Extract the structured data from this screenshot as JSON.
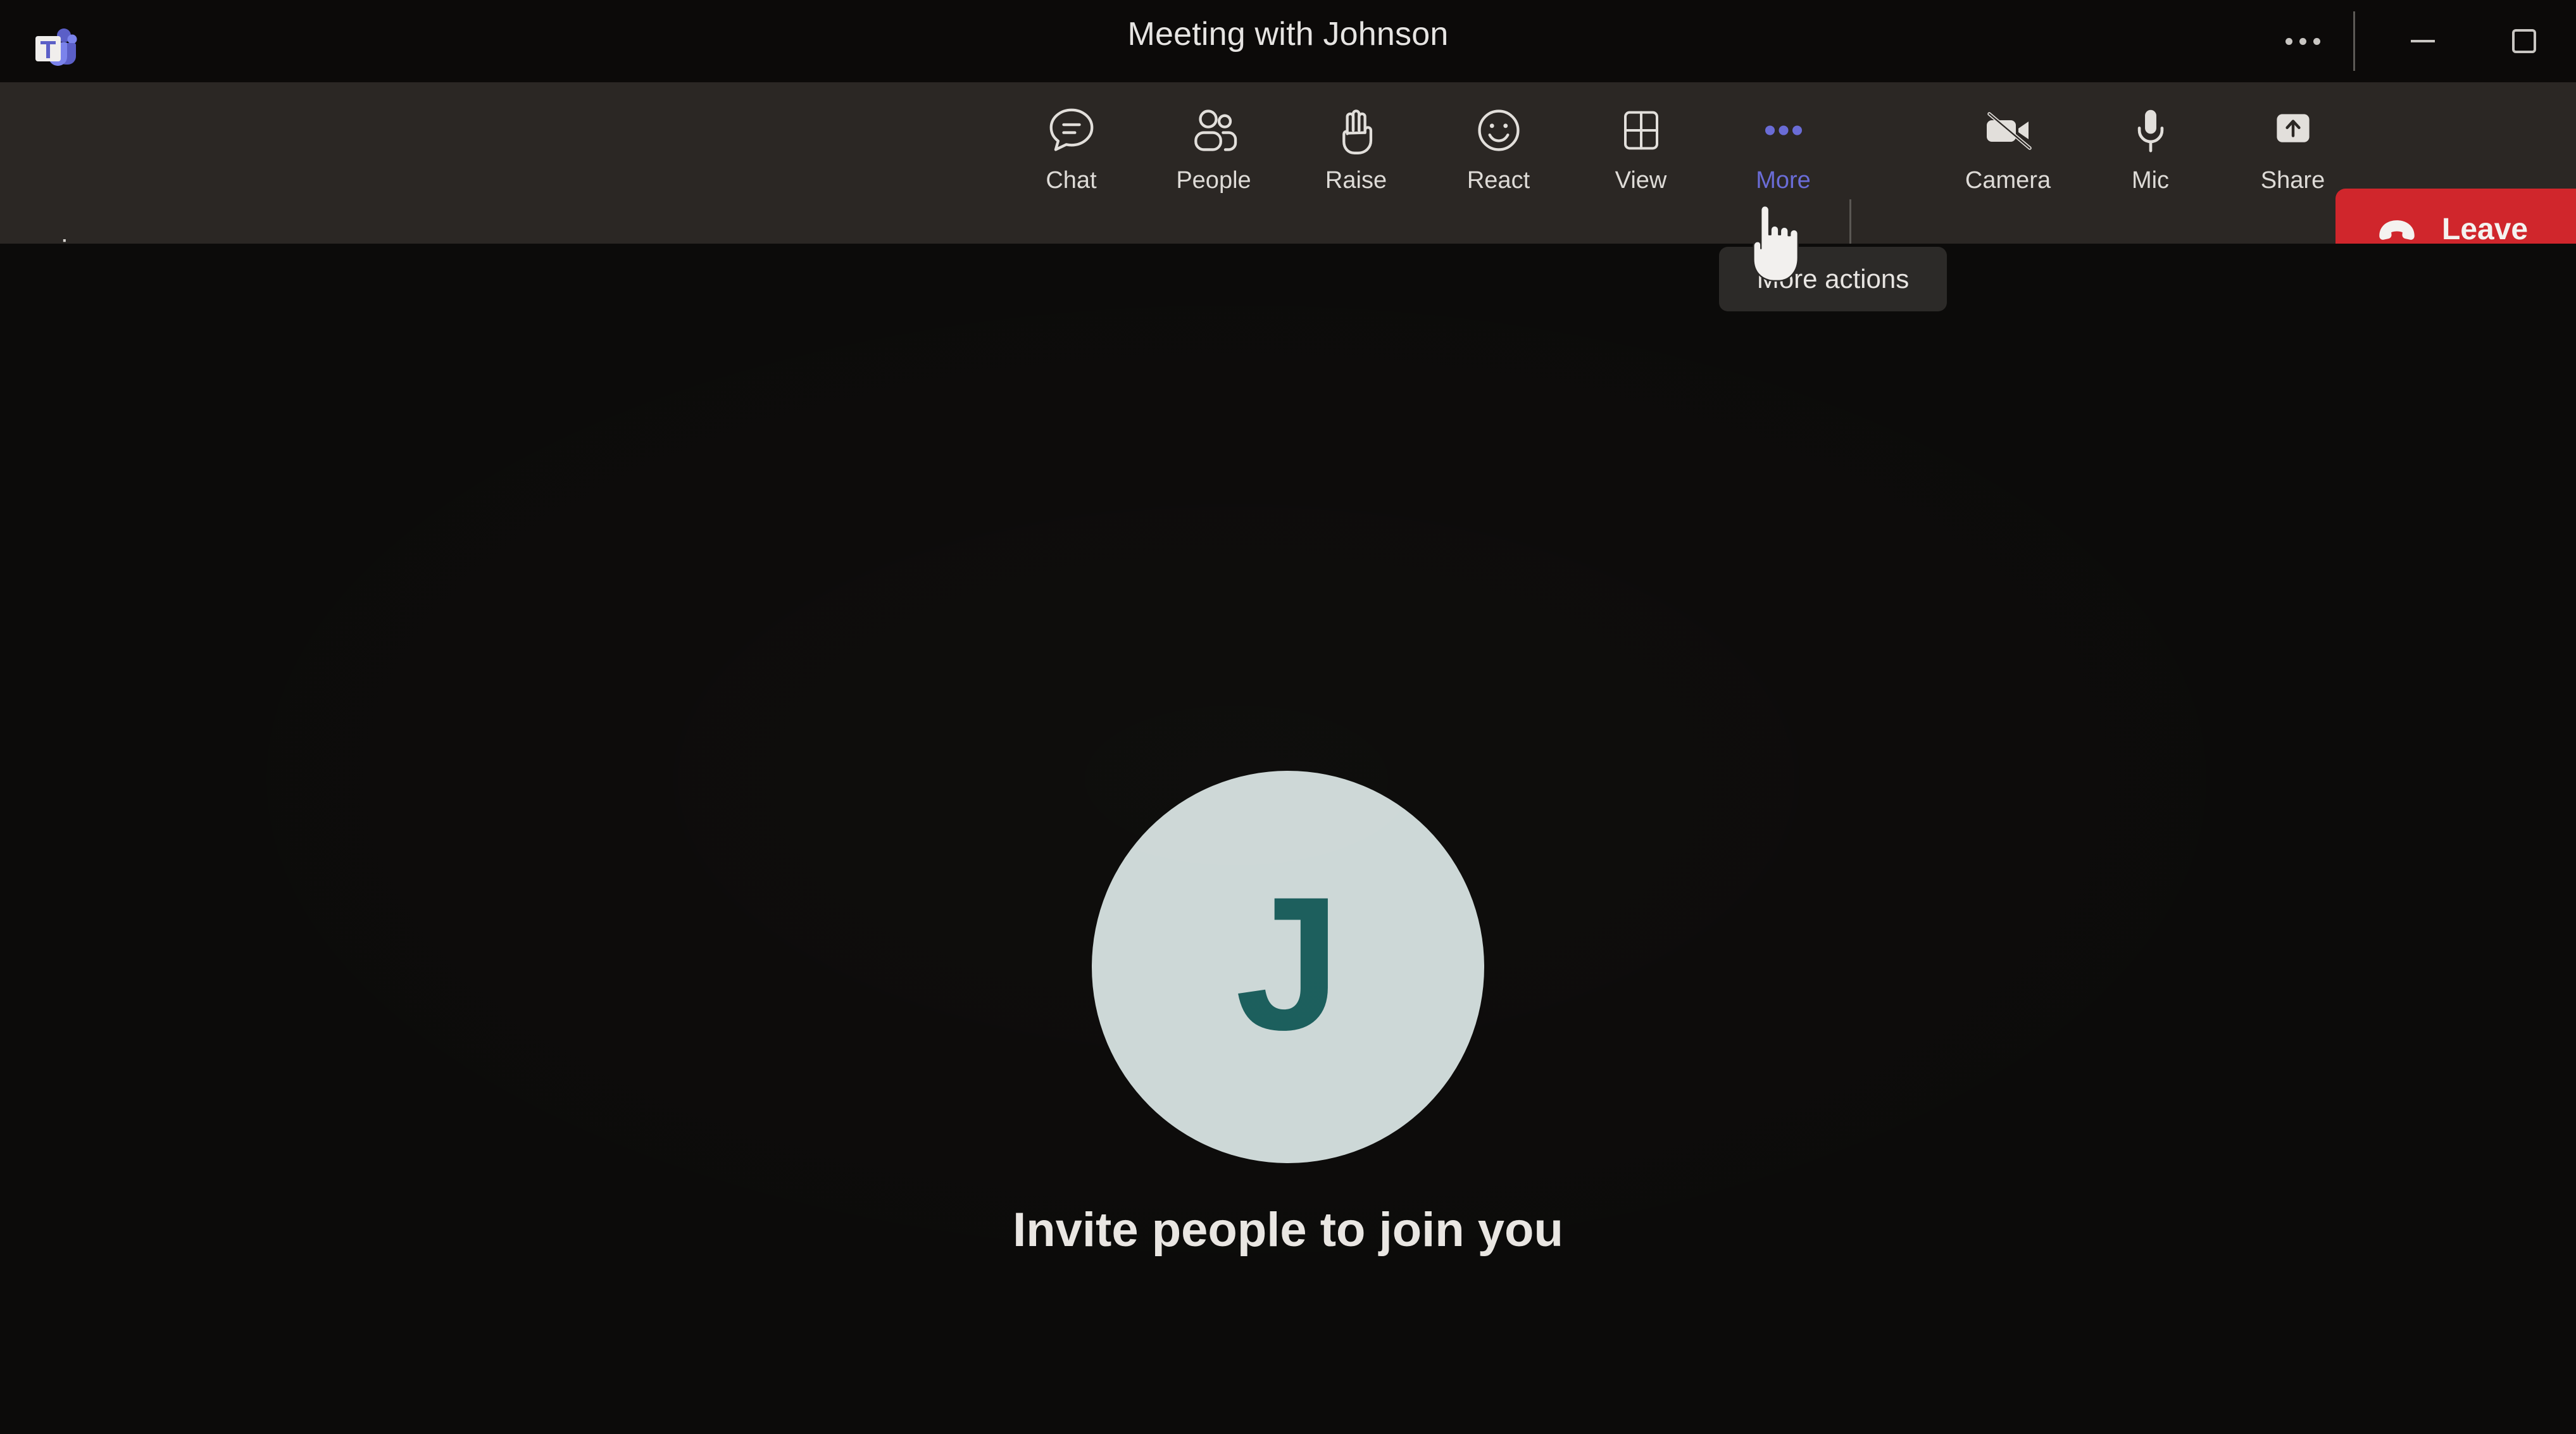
{
  "window": {
    "app_logo": "microsoft-teams-logo",
    "title": "Meeting with Johnson",
    "controls": {
      "more": "…",
      "minimize": "—",
      "maximize": "□"
    }
  },
  "control_bar": {
    "timer": "--:--",
    "buttons": [
      {
        "id": "chat",
        "label": "Chat",
        "icon": "chat-bubble-icon",
        "active": false
      },
      {
        "id": "people",
        "label": "People",
        "icon": "people-icon",
        "active": false
      },
      {
        "id": "raise",
        "label": "Raise",
        "icon": "raise-hand-icon",
        "active": false
      },
      {
        "id": "react",
        "label": "React",
        "icon": "smiley-face-icon",
        "active": false
      },
      {
        "id": "view",
        "label": "View",
        "icon": "grid-view-icon",
        "active": false
      },
      {
        "id": "more",
        "label": "More",
        "icon": "ellipsis-icon",
        "active": true
      },
      {
        "id": "camera",
        "label": "Camera",
        "icon": "camera-off-icon",
        "active": false
      },
      {
        "id": "mic",
        "label": "Mic",
        "icon": "microphone-icon",
        "active": false
      },
      {
        "id": "share",
        "label": "Share",
        "icon": "share-screen-icon",
        "active": false
      }
    ],
    "leave": {
      "label": "Leave",
      "icon": "hang-up-phone-icon",
      "color": "#d0262c"
    }
  },
  "tooltip": {
    "text": "More actions"
  },
  "stage": {
    "avatar_initial": "J",
    "avatar_bg": "#cdd8d7",
    "avatar_fg": "#1b5e5c",
    "invite_text": "Invite people to join you"
  },
  "cursor": {
    "type": "pointing-hand"
  },
  "colors": {
    "titlebar_bg": "#0c0a09",
    "controlbar_bg": "#2b2724",
    "stage_bg": "#0c0b0a",
    "accent_active": "#6a6cd6",
    "tooltip_bg": "#2c2a28"
  }
}
